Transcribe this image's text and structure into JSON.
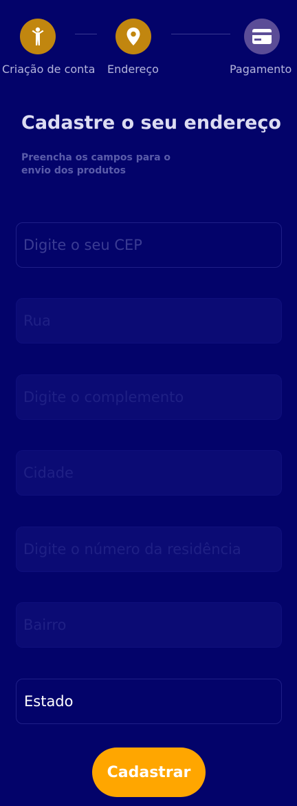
{
  "stepper": {
    "steps": [
      {
        "label": "Criação de conta",
        "icon": "person-icon",
        "state": "done"
      },
      {
        "label": "Endereço",
        "icon": "location-pin-icon",
        "state": "done"
      },
      {
        "label": "Pagamento",
        "icon": "credit-card-icon",
        "state": "pending"
      }
    ]
  },
  "form": {
    "title": "Cadastre o seu endereço",
    "subtitle": "Preencha os campos para o envio dos produtos",
    "cep_placeholder": "Digite o seu CEP",
    "rua_placeholder": "Rua",
    "complemento_placeholder": "Digite o complemento",
    "cidade_placeholder": "Cidade",
    "numero_placeholder": "Digite o número da residência",
    "bairro_placeholder": "Bairro",
    "estado_value": "Estado",
    "submit_label": "Cadastrar"
  },
  "colors": {
    "background": "#03036a",
    "step_done": "#c1860f",
    "step_pending": "#5b4d97",
    "button": "#ffa600"
  }
}
